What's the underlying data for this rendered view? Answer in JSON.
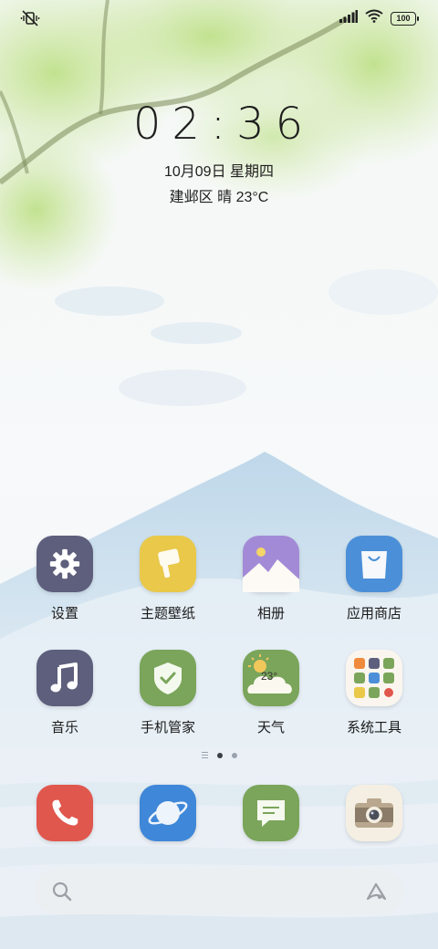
{
  "status_bar": {
    "left_icon": "vibrate-silent-icon",
    "right_icons": [
      "signal-icon",
      "wifi-icon"
    ],
    "battery_level": "100"
  },
  "lock_clock": {
    "time": "02:36",
    "date": "10月09日 星期四",
    "weather": "建邺区 晴 23°C"
  },
  "apps": [
    {
      "label": "设置",
      "icon": "settings-gear-icon",
      "color": "#5e5f7c"
    },
    {
      "label": "主题壁纸",
      "icon": "paint-brush-icon",
      "color": "#e9c84a"
    },
    {
      "label": "相册",
      "icon": "gallery-mountain-icon",
      "color": "#a38ad6"
    },
    {
      "label": "应用商店",
      "icon": "shopping-bag-icon",
      "color": "#4b8fd8"
    },
    {
      "label": "音乐",
      "icon": "music-note-icon",
      "color": "#5d5f7c"
    },
    {
      "label": "手机管家",
      "icon": "shield-check-icon",
      "color": "#7aa55a"
    },
    {
      "label": "天气",
      "icon": "weather-cloud-sun-icon",
      "color": "#7aa55a",
      "temp": "23°"
    },
    {
      "label": "系统工具",
      "icon": "folder-grid-icon",
      "color": "#faf6ef"
    }
  ],
  "dock": [
    {
      "icon": "phone-icon",
      "color": "#e0574d"
    },
    {
      "icon": "browser-planet-icon",
      "color": "#3f87d8"
    },
    {
      "icon": "messages-icon",
      "color": "#7aa55a"
    },
    {
      "icon": "camera-icon",
      "color": "#f5efe3"
    }
  ],
  "page_indicator": {
    "pages": 2,
    "active": 0
  },
  "search_bar": {
    "left_icon": "search-icon",
    "right_icon": "assistant-icon"
  }
}
